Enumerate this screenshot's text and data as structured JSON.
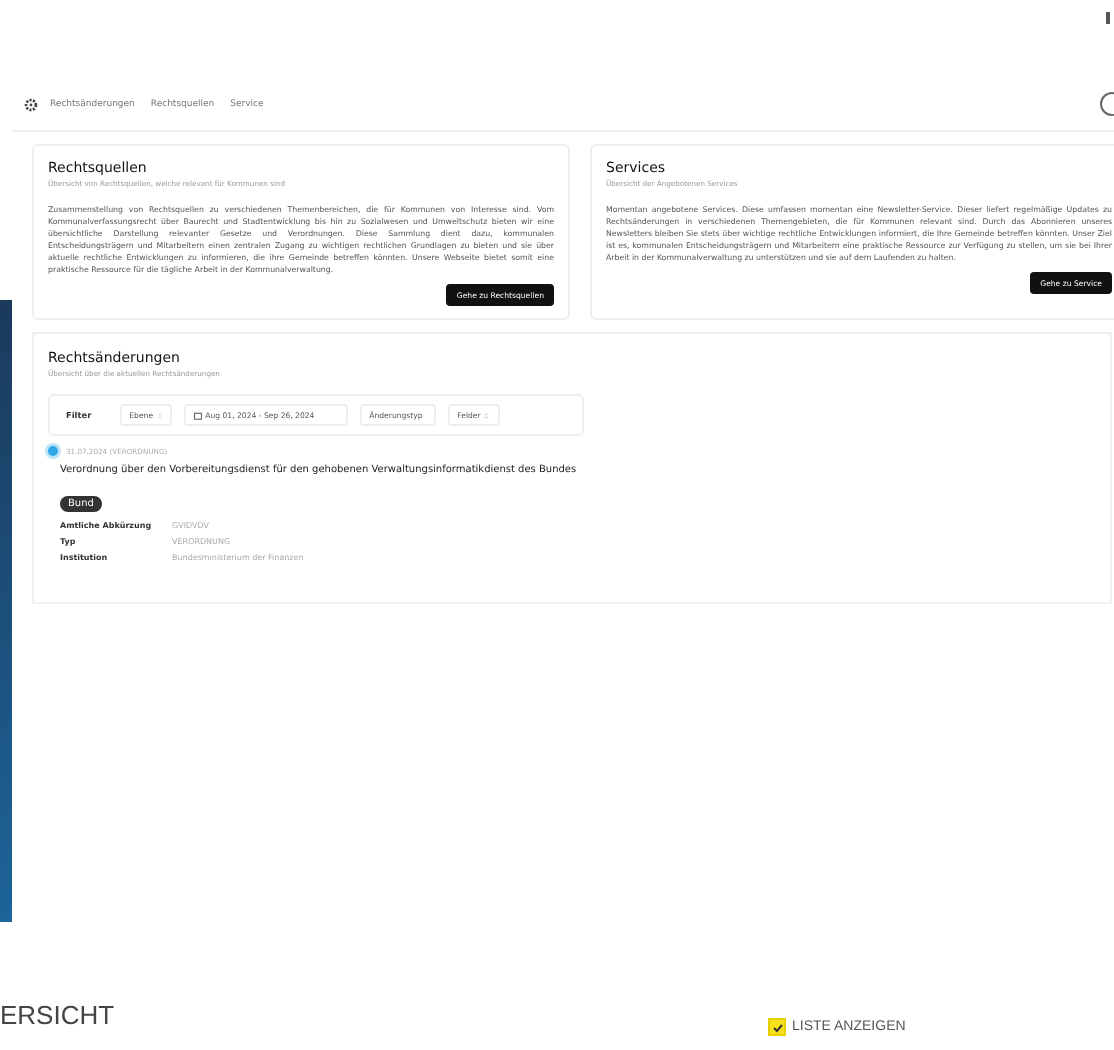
{
  "nav": {
    "items": [
      "Rechtsänderungen",
      "Rechtsquellen",
      "Service"
    ]
  },
  "cards": [
    {
      "title": "Rechtsquellen",
      "subtitle": "Übersicht von Rechtsquellen, welche relevant für Kommunen sind",
      "body": "Zusammenstellung von Rechtsquellen zu verschiedenen Themenbereichen, die für Kommunen von Interesse sind. Vom Kommunalverfassungsrecht über Baurecht und Stadtentwicklung bis hin zu Sozialwesen und Umweltschutz bieten wir eine übersichtliche Darstellung relevanter Gesetze und Verordnungen. Diese Sammlung dient dazu, kommunalen Entscheidungsträgern und Mitarbeitern einen zentralen Zugang zu wichtigen rechtlichen Grundlagen zu bieten und sie über aktuelle rechtliche Entwicklungen zu informieren, die ihre Gemeinde betreffen könnten. Unsere Webseite bietet somit eine praktische Ressource für die tägliche Arbeit in der Kommunalverwaltung.",
      "button": "Gehe zu Rechtsquellen"
    },
    {
      "title": "Services",
      "subtitle": "Übersicht der Angebotenen Services",
      "body": "Momentan angebotene Services. Diese umfassen momentan eine Newsletter-Service. Dieser liefert regelmäßige Updates zu Rechtsänderungen in verschiedenen Themengebieten, die für Kommunen relevant sind. Durch das Abonnieren unseres Newsletters bleiben Sie stets über wichtige rechtliche Entwicklungen informiert, die Ihre Gemeinde betreffen könnten. Unser Ziel ist es, kommunalen Entscheidungsträgern und Mitarbeitern eine praktische Ressource zur Verfügung zu stellen, um sie bei Ihrer Arbeit in der Kommunalverwaltung zu unterstützen und sie auf dem Laufenden zu halten.",
      "button": "Gehe zu Service"
    }
  ],
  "changes": {
    "title": "Rechtsänderungen",
    "subtitle": "Übersicht über die aktuellen Rechtsänderungen",
    "filter": {
      "label": "Filter",
      "controls": [
        {
          "kind": "select",
          "label": "Ebene"
        },
        {
          "kind": "date",
          "label": "Aug 01, 2024 - Sep 26, 2024"
        },
        {
          "kind": "select",
          "label": "Änderungstyp"
        },
        {
          "kind": "select",
          "label": "Felder"
        }
      ]
    },
    "entries": [
      {
        "selected": true,
        "date": "31.07.2024 (VERORDNUNG)",
        "title": "Verordnung über den Vorbereitungsdienst für den gehobenen Verwaltungsinformatikdienst des Bundes",
        "badge": "Bund",
        "fields": [
          {
            "label": "Amtliche Abkürzung",
            "value": "GVIDVDV"
          },
          {
            "label": "Typ",
            "value": "VERORDNUNG"
          },
          {
            "label": "Institution",
            "value": "Bundesministerium der Finanzen"
          }
        ]
      }
    ]
  },
  "bottom": {
    "heading": "ERSICHT",
    "list_toggle": {
      "label": "LISTE ANZEIGEN",
      "checked": true
    }
  }
}
